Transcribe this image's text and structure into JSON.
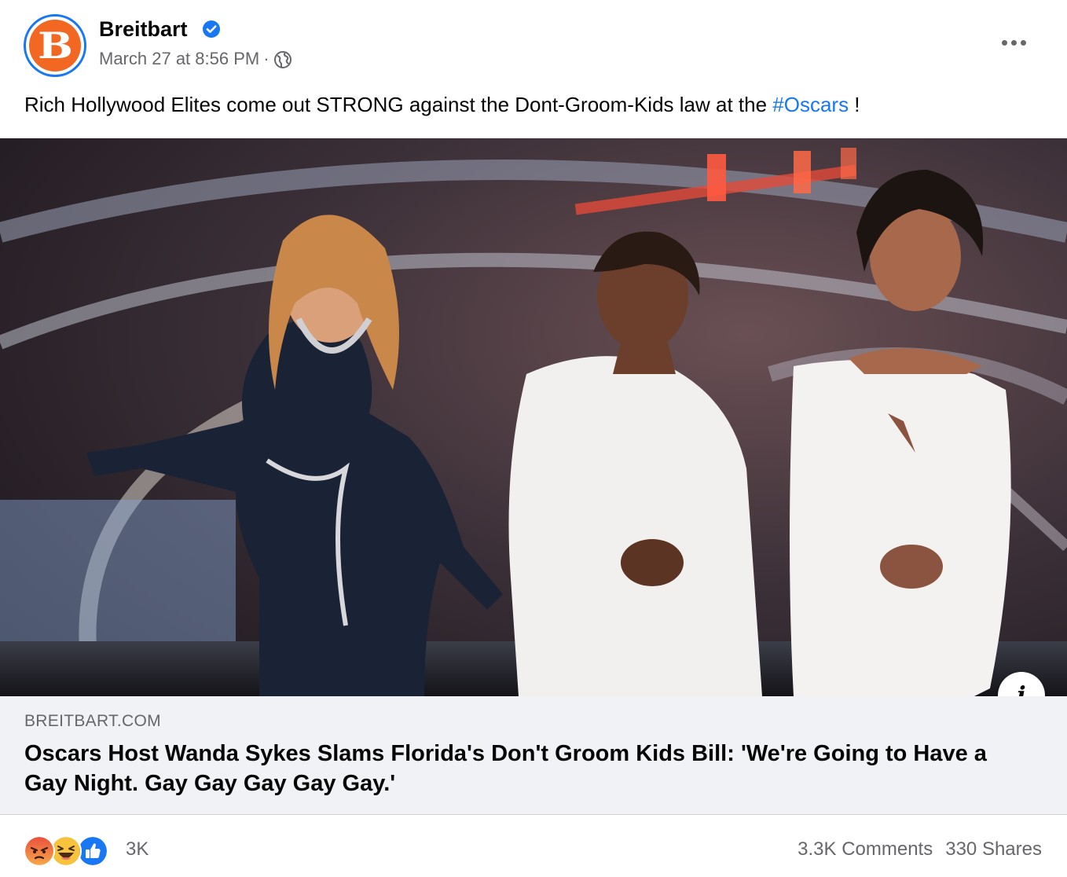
{
  "post": {
    "page_name": "Breitbart",
    "avatar_letter": "B",
    "timestamp": "March 27 at 8:56 PM",
    "separator": "·",
    "audience_icon": "globe-icon",
    "more_icon": "more-horizontal-icon",
    "text_before": "Rich Hollywood Elites come out STRONG against the Dont-Groom-Kids law at the ",
    "hashtag": "#Oscars",
    "text_after": " !"
  },
  "link": {
    "domain": "BREITBART.COM",
    "headline": "Oscars Host Wanda Sykes Slams Florida's Don't Groom Kids Bill: 'We're Going to Have a Gay Night. Gay Gay Gay Gay Gay.'",
    "info_glyph": "i"
  },
  "engagement": {
    "reactions": [
      "angry",
      "haha",
      "like"
    ],
    "reaction_count": "3K",
    "comments": "3.3K Comments",
    "shares": "330 Shares"
  },
  "colors": {
    "brand_orange": "#f26722",
    "link_blue": "#1877f2",
    "secondary_text": "#65676b",
    "link_box_bg": "#f0f2f5"
  }
}
